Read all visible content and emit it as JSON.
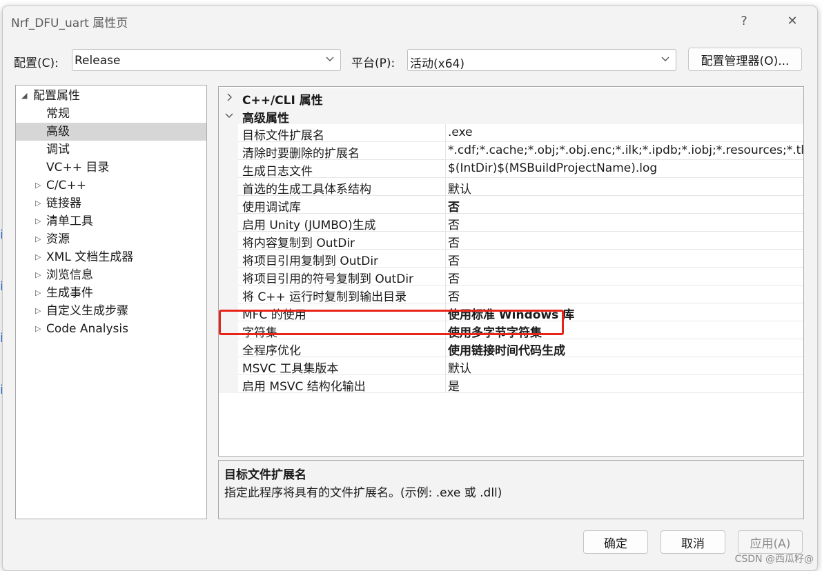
{
  "window": {
    "title": "Nrf_DFU_uart 属性页",
    "help_glyph": "?",
    "close_glyph": "✕"
  },
  "toolbar": {
    "config_label": "配置(C):",
    "config_value": "Release",
    "platform_label": "平台(P):",
    "platform_value": "活动(x64)",
    "config_manager_label": "配置管理器(O)..."
  },
  "tree": {
    "root": "配置属性",
    "items": [
      {
        "label": "常规",
        "expandable": false
      },
      {
        "label": "高级",
        "expandable": false,
        "selected": true
      },
      {
        "label": "调试",
        "expandable": false
      },
      {
        "label": "VC++ 目录",
        "expandable": false
      },
      {
        "label": "C/C++",
        "expandable": true
      },
      {
        "label": "链接器",
        "expandable": true
      },
      {
        "label": "清单工具",
        "expandable": true
      },
      {
        "label": "资源",
        "expandable": true
      },
      {
        "label": "XML 文档生成器",
        "expandable": true
      },
      {
        "label": "浏览信息",
        "expandable": true
      },
      {
        "label": "生成事件",
        "expandable": true
      },
      {
        "label": "自定义生成步骤",
        "expandable": true
      },
      {
        "label": "Code Analysis",
        "expandable": true
      }
    ]
  },
  "grid": {
    "categories": [
      {
        "label": "C++/CLI 属性",
        "expanded": false
      },
      {
        "label": "高级属性",
        "expanded": true
      }
    ],
    "rows": [
      {
        "name": "目标文件扩展名",
        "value": ".exe",
        "bold": false
      },
      {
        "name": "清除时要删除的扩展名",
        "value": "*.cdf;*.cache;*.obj;*.obj.enc;*.ilk;*.ipdb;*.iobj;*.resources;*.tlb;*",
        "bold": false
      },
      {
        "name": "生成日志文件",
        "value": "$(IntDir)$(MSBuildProjectName).log",
        "bold": false
      },
      {
        "name": "首选的生成工具体系结构",
        "value": "默认",
        "bold": false
      },
      {
        "name": "使用调试库",
        "value": "否",
        "bold": true
      },
      {
        "name": "启用 Unity (JUMBO)生成",
        "value": "否",
        "bold": false
      },
      {
        "name": "将内容复制到 OutDir",
        "value": "否",
        "bold": false
      },
      {
        "name": "将项目引用复制到 OutDir",
        "value": "否",
        "bold": false
      },
      {
        "name": "将项目引用的符号复制到 OutDir",
        "value": "否",
        "bold": false
      },
      {
        "name": "将 C++ 运行时复制到输出目录",
        "value": "否",
        "bold": false
      },
      {
        "name": "MFC 的使用",
        "value": "使用标准 Windows 库",
        "bold": true
      },
      {
        "name": "字符集",
        "value": "使用多字节字符集",
        "bold": true
      },
      {
        "name": "全程序优化",
        "value": "使用链接时间代码生成",
        "bold": true
      },
      {
        "name": "MSVC 工具集版本",
        "value": "默认",
        "bold": false
      },
      {
        "name": "启用 MSVC 结构化输出",
        "value": "是",
        "bold": false
      }
    ]
  },
  "description": {
    "title": "目标文件扩展名",
    "text": "指定此程序将具有的文件扩展名。(示例: .exe 或 .dll)"
  },
  "footer": {
    "ok_label": "确定",
    "cancel_label": "取消",
    "apply_label": "应用(A)"
  },
  "watermark": "CSDN @西瓜籽@",
  "colors": {
    "highlight": "#e8231a",
    "selection": "#d6d6d6"
  }
}
